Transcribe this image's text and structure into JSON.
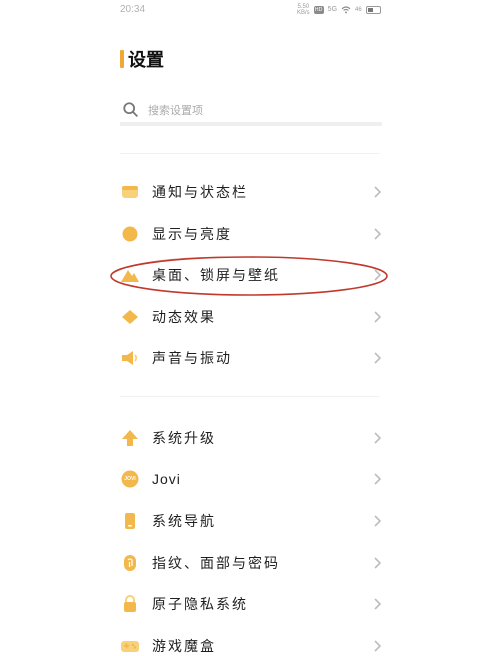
{
  "status_bar": {
    "time": "20:34",
    "speed_top": "5.50",
    "speed_bottom": "KB/s",
    "hd_label": "HD",
    "network_label": "5G",
    "battery_label": "46",
    "battery_level": 0.46
  },
  "header": {
    "title": "设置",
    "accent_color": "#f0a832"
  },
  "search": {
    "placeholder": "搜索设置项"
  },
  "groups": [
    {
      "items": [
        {
          "label": "通知与状态栏",
          "icon": "notification-bar-icon"
        },
        {
          "label": "显示与亮度",
          "icon": "brightness-icon"
        },
        {
          "label": "桌面、锁屏与壁纸",
          "icon": "wallpaper-icon",
          "highlighted": true
        },
        {
          "label": "动态效果",
          "icon": "motion-effect-icon"
        },
        {
          "label": "声音与振动",
          "icon": "speaker-icon"
        }
      ]
    },
    {
      "items": [
        {
          "label": "系统升级",
          "icon": "upgrade-arrow-icon"
        },
        {
          "label": "Jovi",
          "icon": "jovi-icon",
          "icon_text": "JOVI"
        },
        {
          "label": "系统导航",
          "icon": "phone-navigation-icon"
        },
        {
          "label": "指纹、面部与密码",
          "icon": "fingerprint-icon"
        },
        {
          "label": "原子隐私系统",
          "icon": "privacy-icon"
        },
        {
          "label": "游戏魔盒",
          "icon": "game-box-icon"
        }
      ]
    }
  ],
  "colors": {
    "icon_primary": "#f2b84b",
    "icon_secondary": "#f7d27a",
    "chevron": "#bdbdbd",
    "highlight_ring": "#c0392b"
  }
}
